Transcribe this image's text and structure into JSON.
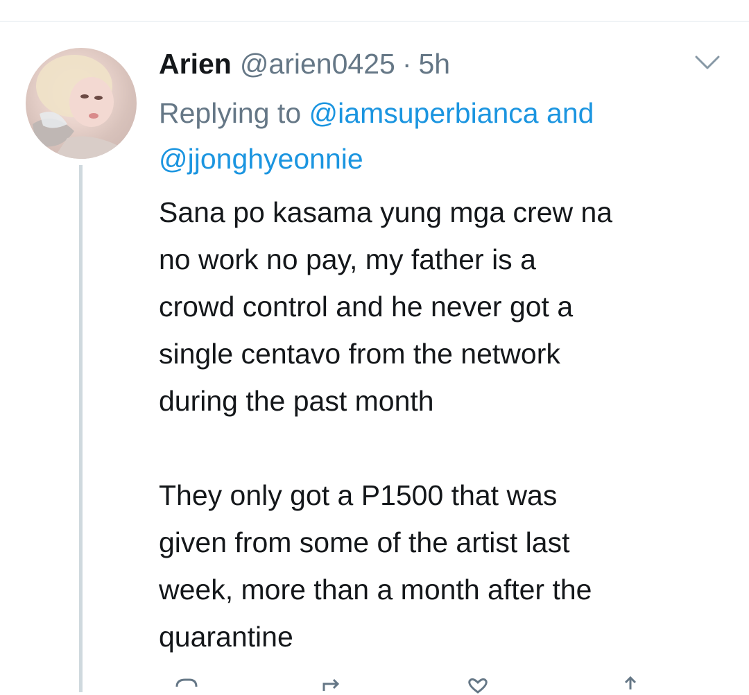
{
  "tweet": {
    "display_name": "Arien",
    "handle": "@arien0425",
    "separator": "·",
    "time": "5h",
    "replying_prefix": "Replying to",
    "mention_1": "@iamsuperbianca",
    "conjunction": "and",
    "mention_2": "@jjonghyeonnie",
    "body": "Sana po kasama yung mga crew na\nno work no pay, my father is a\ncrowd control and he never got a\nsingle centavo from the network\nduring the past month\n\nThey only got a P1500 that was\ngiven from some of the artist last\nweek, more than a month after the\nquarantine"
  },
  "icons": {
    "menu": "chevron-down-icon",
    "reply": "reply-icon",
    "retweet": "retweet-icon",
    "like": "heart-icon",
    "share": "share-icon"
  },
  "colors": {
    "text": "#14171a",
    "secondary": "#657786",
    "link": "#1b95e0",
    "thread_line": "#cfd9de",
    "divider": "#e1e8ed"
  }
}
